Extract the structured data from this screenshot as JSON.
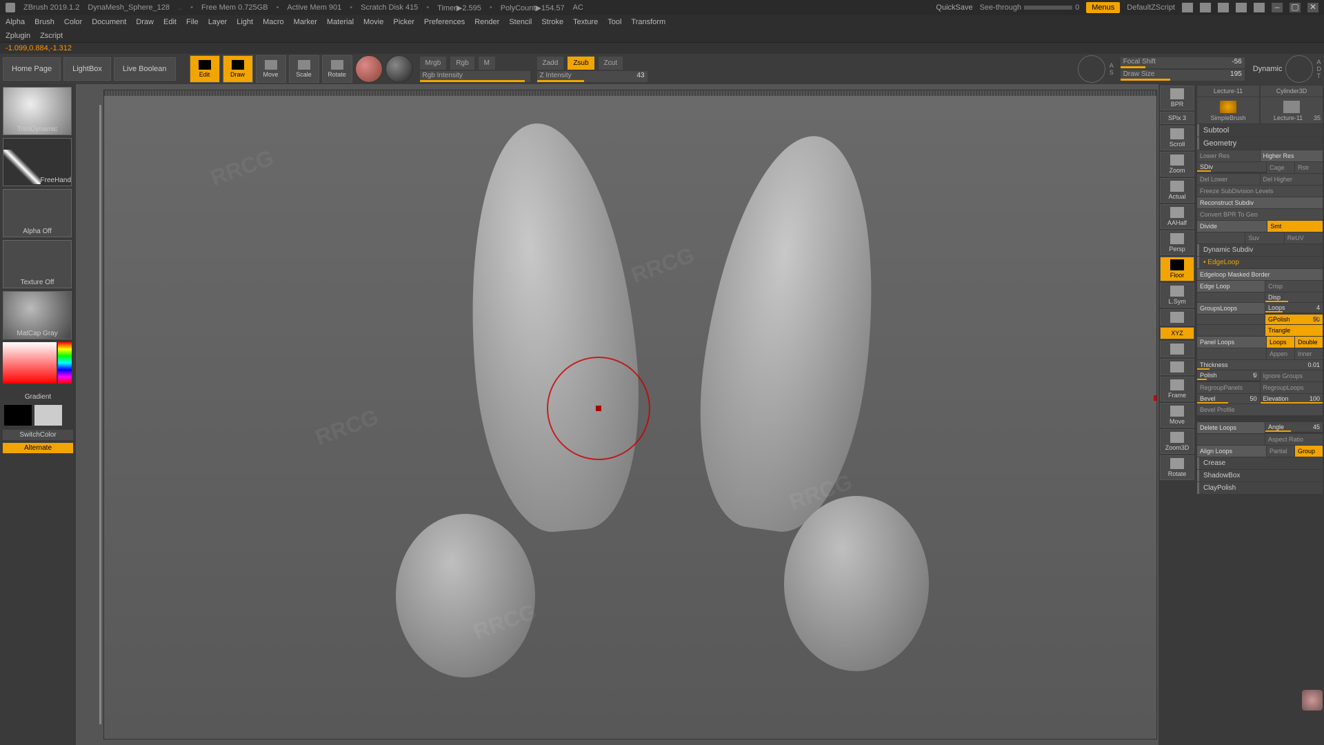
{
  "title_bar": {
    "app": "ZBrush 2019.1.2",
    "project": "DynaMesh_Sphere_128",
    "dots": "..",
    "free_mem": "Free Mem 0.725GB",
    "active_mem": "Active Mem 901",
    "scratch": "Scratch Disk 415",
    "timer": "Timer▶2.595",
    "polycount": "PolyCount▶154.57",
    "ac": "AC",
    "quicksave": "QuickSave",
    "seethrough": "See-through",
    "seethrough_val": "0",
    "menus": "Menus",
    "zscript": "DefaultZScript"
  },
  "menus": [
    "Alpha",
    "Brush",
    "Color",
    "Document",
    "Draw",
    "Edit",
    "File",
    "Layer",
    "Light",
    "Macro",
    "Marker",
    "Material",
    "Movie",
    "Picker",
    "Preferences",
    "Render",
    "Stencil",
    "Stroke",
    "Texture",
    "Tool",
    "Transform"
  ],
  "menus2": [
    "Zplugin",
    "Zscript"
  ],
  "coord": "-1.099,0.884,-1.312",
  "header": {
    "home": "Home Page",
    "lightbox": "LightBox",
    "liveboolean": "Live Boolean",
    "edit": "Edit",
    "draw": "Draw",
    "move": "Move",
    "scale": "Scale",
    "rotate": "Rotate",
    "mrgb": "Mrgb",
    "rgb": "Rgb",
    "m": "M",
    "rgbint": "Rgb Intensity",
    "zadd": "Zadd",
    "zsub": "Zsub",
    "zcut": "Zcut",
    "zint": "Z Intensity",
    "zint_val": "43",
    "focal": "Focal Shift",
    "focal_val": "-56",
    "drawsize": "Draw Size",
    "drawsize_val": "195",
    "dynamic": "Dynamic",
    "s": "S",
    "a": "A",
    "d": "D",
    "t": "T"
  },
  "left": {
    "brush": "TrimDynamic",
    "stroke": "FreeHand",
    "alpha": "Alpha Off",
    "texture": "Texture Off",
    "material": "MatCap Gray",
    "gradient": "Gradient",
    "switch": "SwitchColor",
    "alternate": "Alternate"
  },
  "right_buttons": [
    "BPR",
    "SPix 3",
    "Scroll",
    "Zoom",
    "Actual",
    "AAHalf",
    "Persp",
    "Floor",
    "L.Sym",
    "",
    "",
    "XYZ",
    "",
    "",
    "Frame",
    "Move",
    "Zoom3D",
    "Rotate"
  ],
  "right_panel": {
    "slot1_top": "Lecture-11",
    "slot2_top": "Cylinder3D",
    "slot1_bot": "SimpleBrush",
    "slot2_bot": "Lecture-11",
    "count": "35",
    "subtool": "Subtool",
    "geometry": "Geometry",
    "lowerres": "Lower Res",
    "higherres": "Higher Res",
    "sdiv": "SDiv",
    "cage": "Cage",
    "rstr": "Rstr",
    "dellower": "Del Lower",
    "delhigher": "Del Higher",
    "freeze": "Freeze SubDivision Levels",
    "reconstruct": "Reconstruct Subdiv",
    "convert": "Convert BPR To Geo",
    "divide": "Divide",
    "smt": "Smt",
    "suv": "Suv",
    "reuv": "ReUV",
    "dynsubdiv": "Dynamic Subdiv",
    "edgeloop": "EdgeLoop",
    "edgeloopmasked": "Edgeloop Masked Border",
    "edgeloop2": "Edge Loop",
    "crisp": "Crisp",
    "disp": "Disp",
    "groupsloops": "GroupsLoops",
    "loops": "Loops",
    "loops_val": "4",
    "gpolish": "GPolish",
    "gpolish_val": "50",
    "triangle": "Triangle",
    "panelloops": "Panel Loops",
    "loops2": "Loops",
    "double": "Double",
    "append": "Appen",
    "inner": "Inner",
    "thickness": "Thickness",
    "thickness_val": "0.01",
    "polish": "Polish",
    "polish_val": "5",
    "ignoregroups": "Ignore Groups",
    "regrouppanels": "RegroupPanels",
    "regrouploops": "RegroupLoops",
    "bevel": "Bevel",
    "bevel_val": "50",
    "elevation": "Elevation",
    "elevation_val": "100",
    "bevelprofile": "Bevel Profile",
    "deleteloops": "Delete Loops",
    "angle": "Angle",
    "angle_val": "45",
    "aspectratio": "Aspect Ratio",
    "alignloops": "Align Loops",
    "partial": "Partial",
    "group": "Group",
    "crease": "Crease",
    "shadowbox": "ShadowBox",
    "claypolish": "ClayPolish"
  },
  "watermark": "RRCG"
}
